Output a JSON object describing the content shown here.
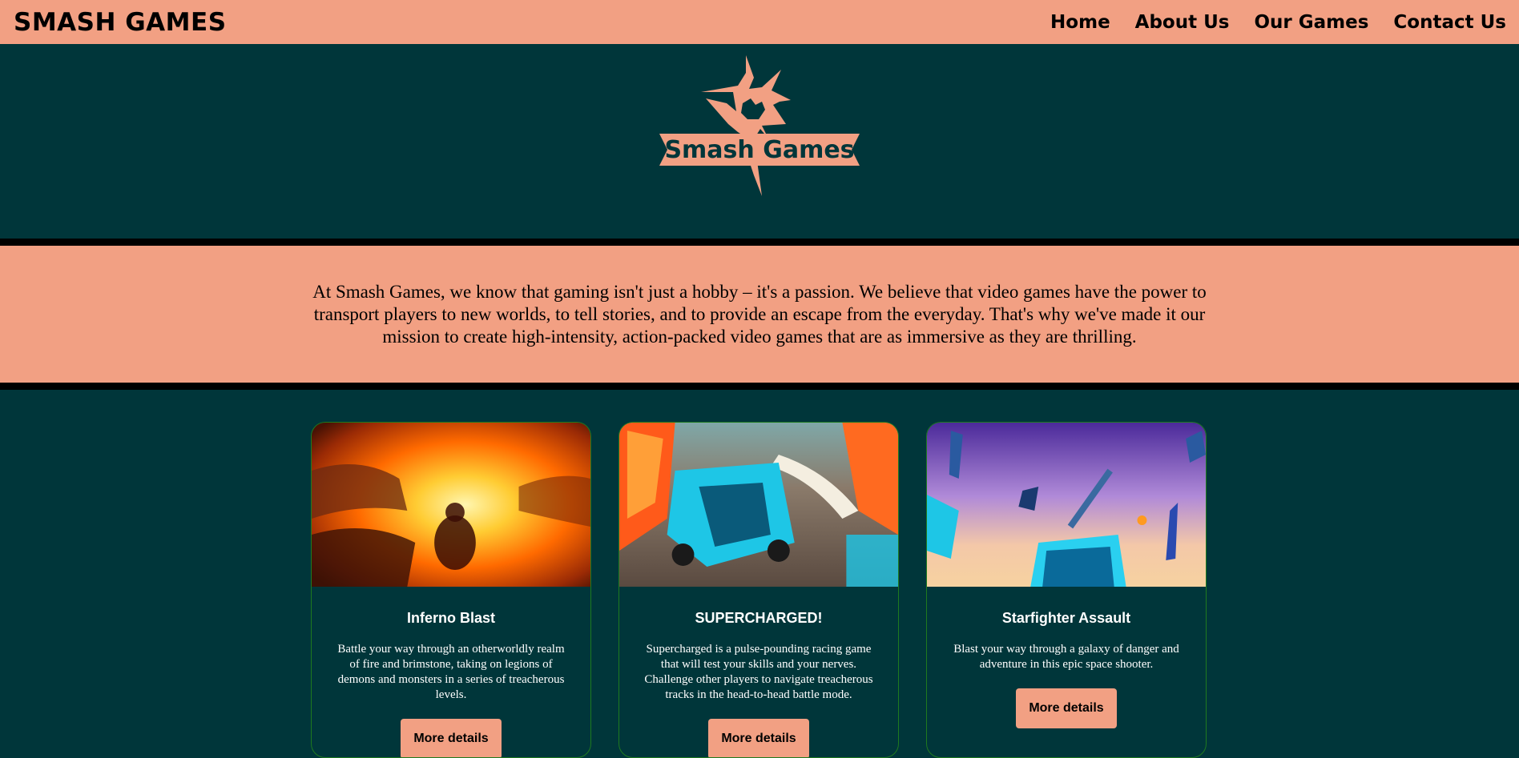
{
  "nav": {
    "brand": "SMASH GAMES",
    "links": [
      "Home",
      "About Us",
      "Our Games",
      "Contact Us"
    ]
  },
  "hero": {
    "logo_text": "Smash Games"
  },
  "about": {
    "text": "At Smash Games, we know that gaming isn't just a hobby – it's a passion. We believe that video games have the power to transport players to new worlds, to tell stories, and to provide an escape from the everyday. That's why we've made it our mission to create high-intensity, action-packed video games that are as immersive as they are thrilling."
  },
  "games": [
    {
      "title": "Inferno Blast",
      "description": "Battle your way through an otherworldly realm of fire and brimstone, taking on legions of demons and monsters in a series of treacherous levels.",
      "button": "More details"
    },
    {
      "title": "SUPERCHARGED!",
      "description": "Supercharged is a pulse-pounding racing game that will test your skills and your nerves. Challenge other players to navigate treacherous tracks in the head-to-head battle mode.",
      "button": "More details"
    },
    {
      "title": "Starfighter Assault",
      "description": "Blast your way through a galaxy of danger and adventure in this epic space shooter.",
      "button": "More details"
    }
  ],
  "colors": {
    "accent": "#f2a083",
    "background": "#00363a",
    "divider": "#000000"
  }
}
